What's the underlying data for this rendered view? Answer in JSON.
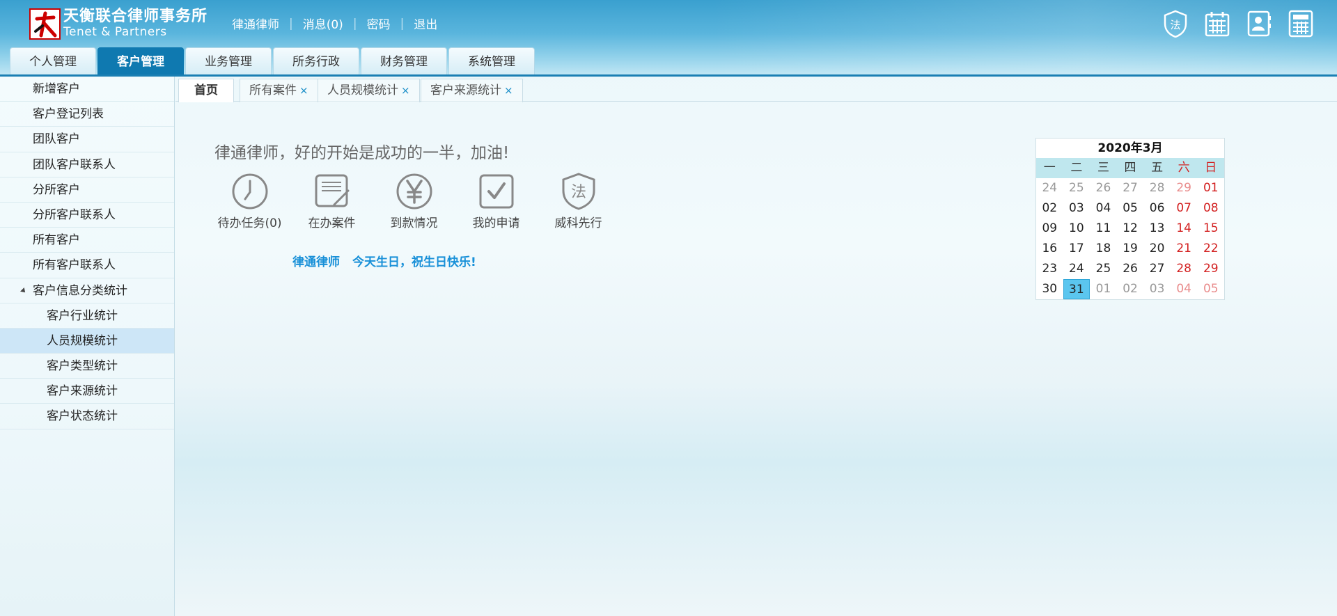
{
  "header": {
    "logo_cn": "天衡联合律师事务所",
    "logo_en": "Tenet & Partners",
    "user": "律通律师",
    "messages": "消息(0)",
    "password": "密码",
    "logout": "退出",
    "icons": [
      "law-shield-icon",
      "calendar-icon",
      "contacts-icon",
      "calculator-icon"
    ]
  },
  "main_tabs": [
    "个人管理",
    "客户管理",
    "业务管理",
    "所务行政",
    "财务管理",
    "系统管理"
  ],
  "main_tab_active": "客户管理",
  "sidebar": {
    "items": [
      {
        "label": "新增客户"
      },
      {
        "label": "客户登记列表"
      },
      {
        "label": "团队客户"
      },
      {
        "label": "团队客户联系人"
      },
      {
        "label": "分所客户"
      },
      {
        "label": "分所客户联系人"
      },
      {
        "label": "所有客户"
      },
      {
        "label": "所有客户联系人"
      },
      {
        "label": "客户信息分类统计"
      },
      {
        "label": "客户行业统计"
      },
      {
        "label": "人员规模统计"
      },
      {
        "label": "客户类型统计"
      },
      {
        "label": "客户来源统计"
      },
      {
        "label": "客户状态统计"
      }
    ],
    "selected": "人员规模统计"
  },
  "content_tabs": {
    "home": "首页",
    "tabs": [
      {
        "label": "所有案件",
        "close": "×"
      },
      {
        "label": "人员规模统计",
        "close": "×"
      },
      {
        "label": "客户来源统计",
        "close": "×"
      }
    ]
  },
  "welcome": "律通律师，好的开始是成功的一半，加油!",
  "quick": [
    {
      "label": "待办任务(0)",
      "icon": "clock-icon"
    },
    {
      "label": "在办案件",
      "icon": "document-edit-icon"
    },
    {
      "label": "到款情况",
      "icon": "yen-icon"
    },
    {
      "label": "我的申请",
      "icon": "checkbox-icon"
    },
    {
      "label": "威科先行",
      "icon": "law-shield-icon"
    }
  ],
  "birthday": {
    "name": "律通律师",
    "message": "今天生日，祝生日快乐!"
  },
  "calendar": {
    "title": "2020年3月",
    "weekdays": [
      "一",
      "二",
      "三",
      "四",
      "五",
      "六",
      "日"
    ],
    "weeks": [
      [
        "24",
        "25",
        "26",
        "27",
        "28",
        "29",
        "01"
      ],
      [
        "02",
        "03",
        "04",
        "05",
        "06",
        "07",
        "08"
      ],
      [
        "09",
        "10",
        "11",
        "12",
        "13",
        "14",
        "15"
      ],
      [
        "16",
        "17",
        "18",
        "19",
        "20",
        "21",
        "22"
      ],
      [
        "23",
        "24",
        "25",
        "26",
        "27",
        "28",
        "29"
      ],
      [
        "30",
        "31",
        "01",
        "02",
        "03",
        "04",
        "05"
      ]
    ],
    "today": "31"
  },
  "colors": {
    "accent": "#0f79b0",
    "birthday": "#1890d8",
    "weekend": "#d32020",
    "today": "#5bc6ef"
  }
}
